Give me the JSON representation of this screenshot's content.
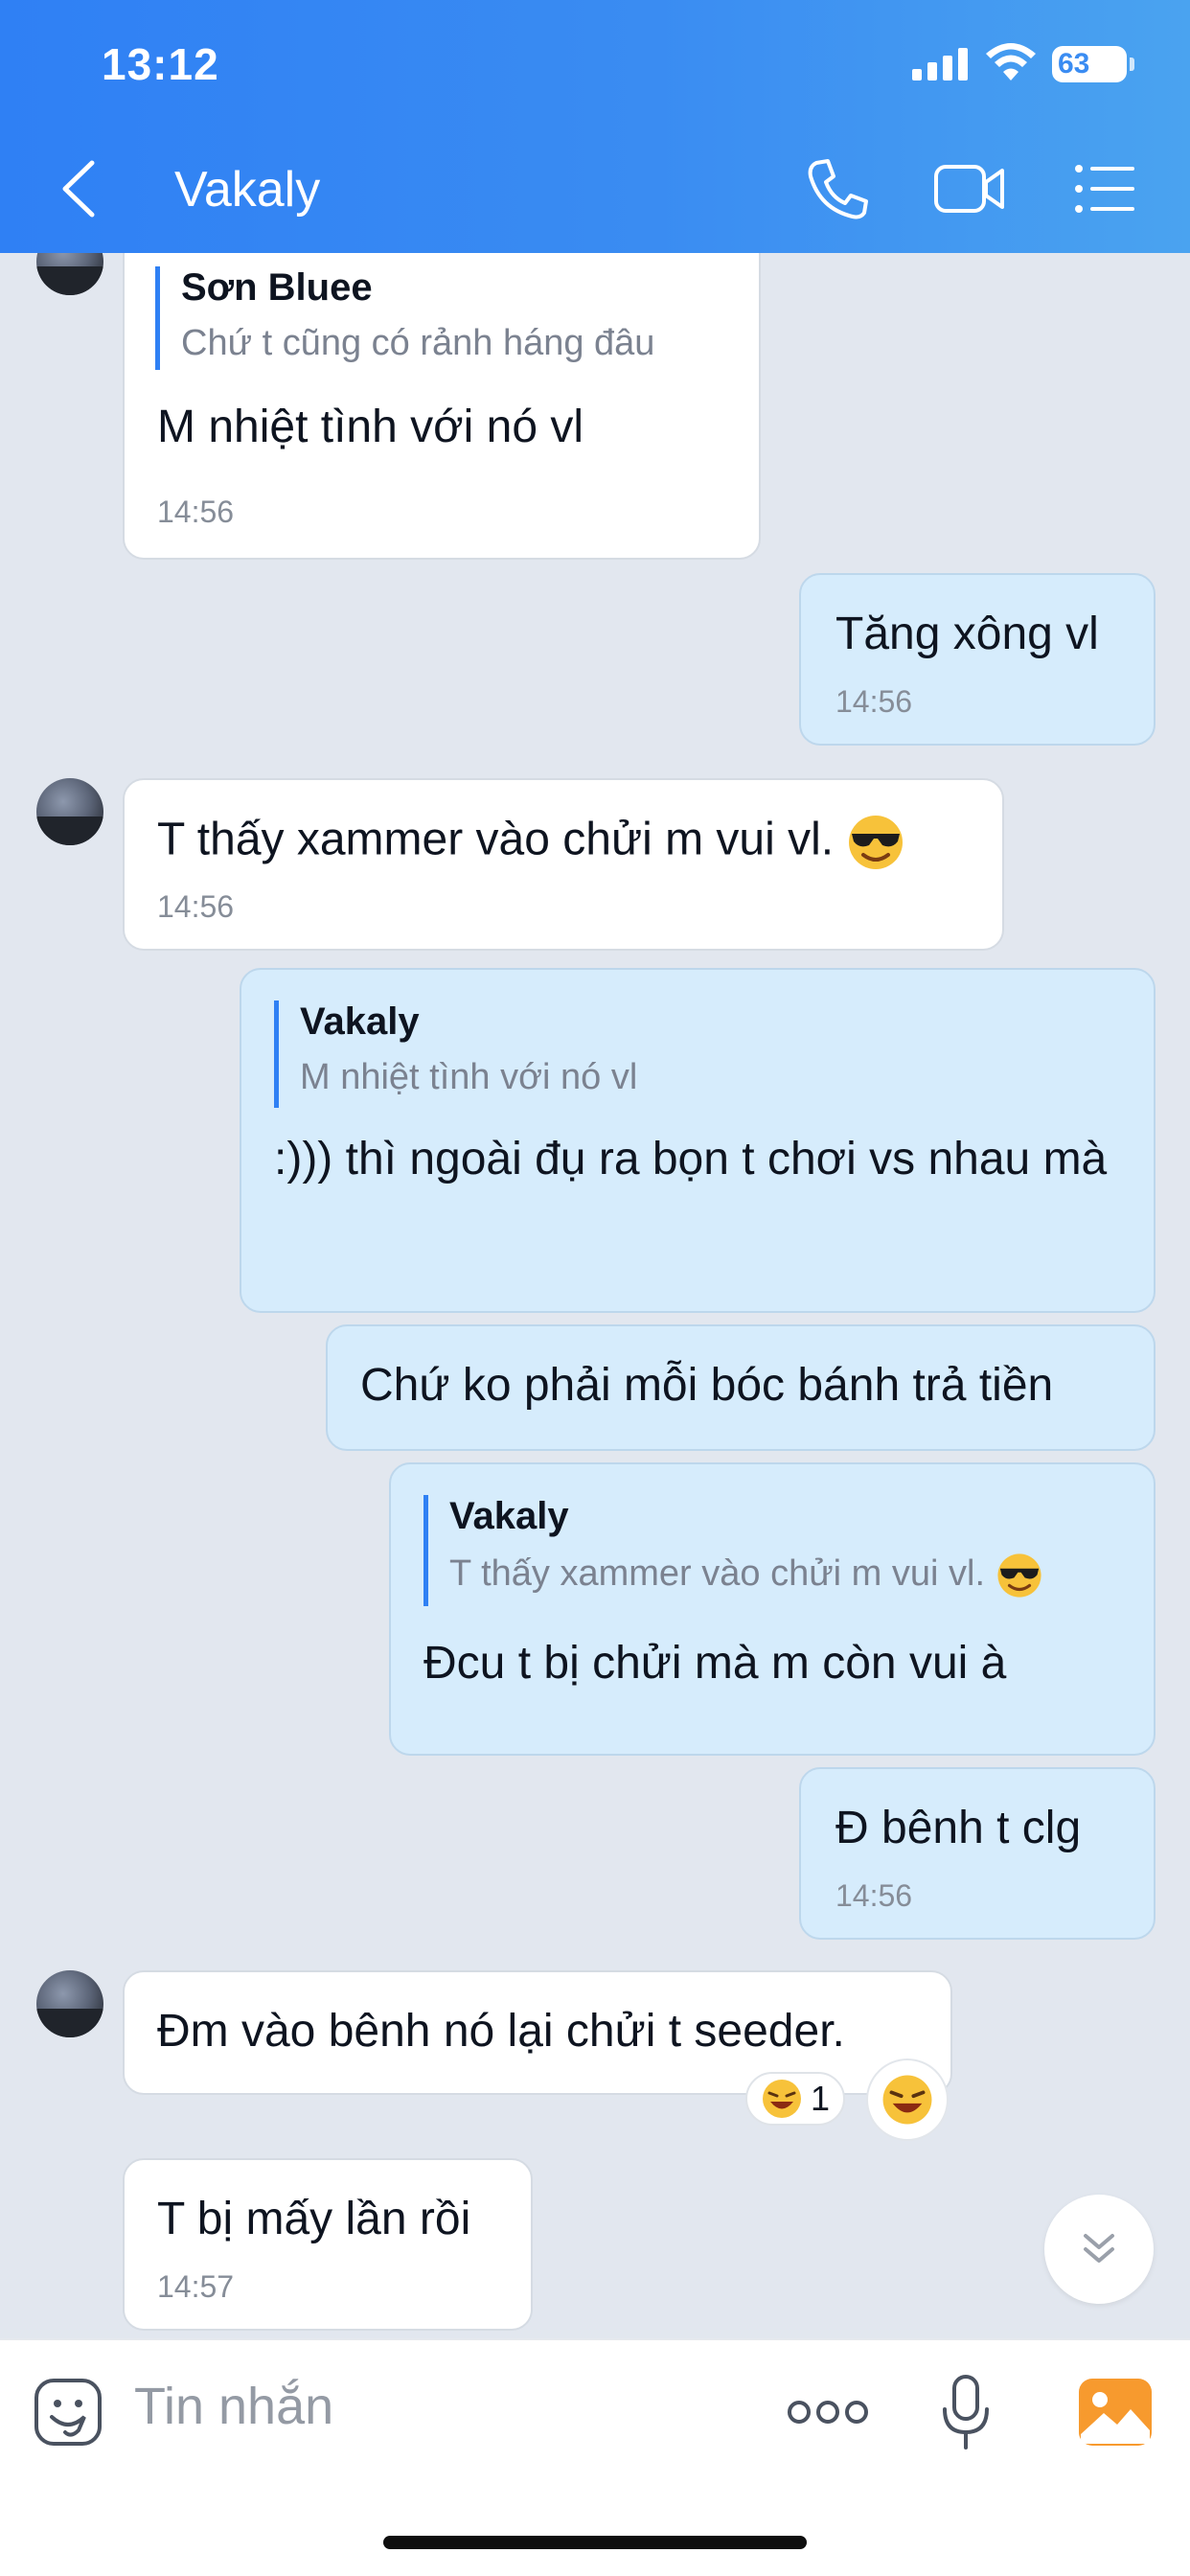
{
  "status_bar": {
    "time": "13:12",
    "battery": "63"
  },
  "header": {
    "title": "Vakaly",
    "icons": [
      "back-arrow-icon",
      "phone-icon",
      "video-call-icon",
      "menu-list-icon"
    ]
  },
  "messages": [
    {
      "id": "m1",
      "side": "in",
      "quote_name": "Sơn Bluee",
      "quote_text": "Chứ t cũng có rảnh háng đâu",
      "text": "M nhiệt tình với nó vl",
      "time": "14:56"
    },
    {
      "id": "m2",
      "side": "out",
      "text": "Tăng xông vl",
      "time": "14:56"
    },
    {
      "id": "m3",
      "side": "in",
      "text": "T thấy xammer vào chửi m vui vl.",
      "emoji": "sunglasses-face",
      "time": "14:56"
    },
    {
      "id": "m4",
      "side": "out",
      "quote_name": "Vakaly",
      "quote_text": "M nhiệt tình với nó vl",
      "text": ":))) thì ngoài đụ ra bọn t chơi vs nhau mà"
    },
    {
      "id": "m5",
      "side": "out",
      "text": "Chứ ko phải mỗi bóc bánh trả tiền"
    },
    {
      "id": "m6",
      "side": "out",
      "quote_name": "Vakaly",
      "quote_text": "T thấy xammer vào chửi m vui vl.",
      "text": "Đcu t bị chửi mà m còn vui à"
    },
    {
      "id": "m7",
      "side": "out",
      "text": "Đ bênh t clg",
      "time": "14:56"
    },
    {
      "id": "m8",
      "side": "in",
      "text": "Đm vào bênh nó lại chửi t seeder.",
      "reaction_count": "1",
      "reaction_emoji": "laughing-face"
    },
    {
      "id": "m9",
      "side": "in",
      "text": "T bị mấy lần rồi",
      "time": "14:57"
    }
  ],
  "input": {
    "placeholder": "Tin nhắn"
  },
  "colors": {
    "header_start": "#2f80f4",
    "header_end": "#4aa3f0",
    "outgoing_bubble": "#d6ecfc",
    "incoming_bubble": "#ffffff",
    "background": "#e2e7ef",
    "accent": "#2f80f4"
  }
}
